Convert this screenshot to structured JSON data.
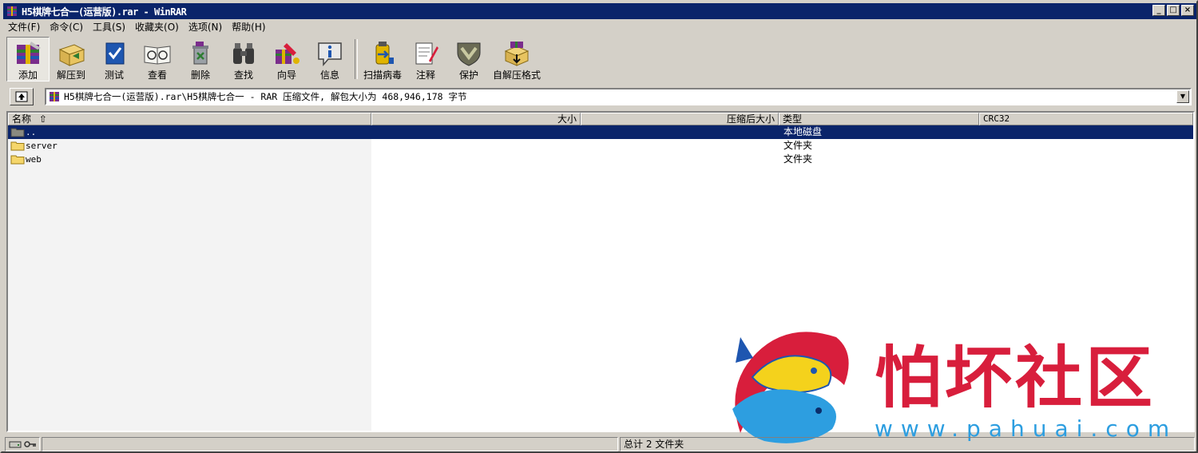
{
  "window": {
    "title": "H5棋牌七合一(运营版).rar - WinRAR",
    "controls": {
      "minimize": "_",
      "maximize": "□",
      "close": "×"
    }
  },
  "menu": {
    "items": [
      "文件(F)",
      "命令(C)",
      "工具(S)",
      "收藏夹(O)",
      "选项(N)",
      "帮助(H)"
    ]
  },
  "toolbar": {
    "buttons": [
      {
        "label": "添加",
        "icon": "add-archive-icon"
      },
      {
        "label": "解压到",
        "icon": "extract-to-icon"
      },
      {
        "label": "测试",
        "icon": "test-icon"
      },
      {
        "label": "查看",
        "icon": "view-icon"
      },
      {
        "label": "删除",
        "icon": "delete-icon"
      },
      {
        "label": "查找",
        "icon": "find-binoculars-icon"
      },
      {
        "label": "向导",
        "icon": "wizard-icon"
      },
      {
        "label": "信息",
        "icon": "info-icon"
      },
      {
        "label": "扫描病毒",
        "icon": "virus-scan-icon"
      },
      {
        "label": "注释",
        "icon": "comment-icon"
      },
      {
        "label": "保护",
        "icon": "protect-shield-icon"
      },
      {
        "label": "自解压格式",
        "icon": "sfx-icon"
      }
    ]
  },
  "address": {
    "text": "H5棋牌七合一(运营版).rar\\H5棋牌七合一 - RAR 压缩文件, 解包大小为 468,946,178 字节"
  },
  "columns": {
    "name": "名称",
    "size": "大小",
    "packed": "压缩后大小",
    "type": "类型",
    "crc": "CRC32"
  },
  "files": [
    {
      "name": "..",
      "type": "本地磁盘",
      "selected": true
    },
    {
      "name": "server",
      "type": "文件夹",
      "selected": false
    },
    {
      "name": "web",
      "type": "文件夹",
      "selected": false
    }
  ],
  "status": {
    "summary": "总计 2 文件夹"
  },
  "watermark": {
    "title": "怕坏社区",
    "url": "www.pahuai.com"
  },
  "colors": {
    "titlebar": "#0a246a",
    "selection": "#0a246a",
    "face": "#d4d0c8",
    "watermark_red": "#d81e3c",
    "watermark_blue": "#2d9ee0"
  }
}
